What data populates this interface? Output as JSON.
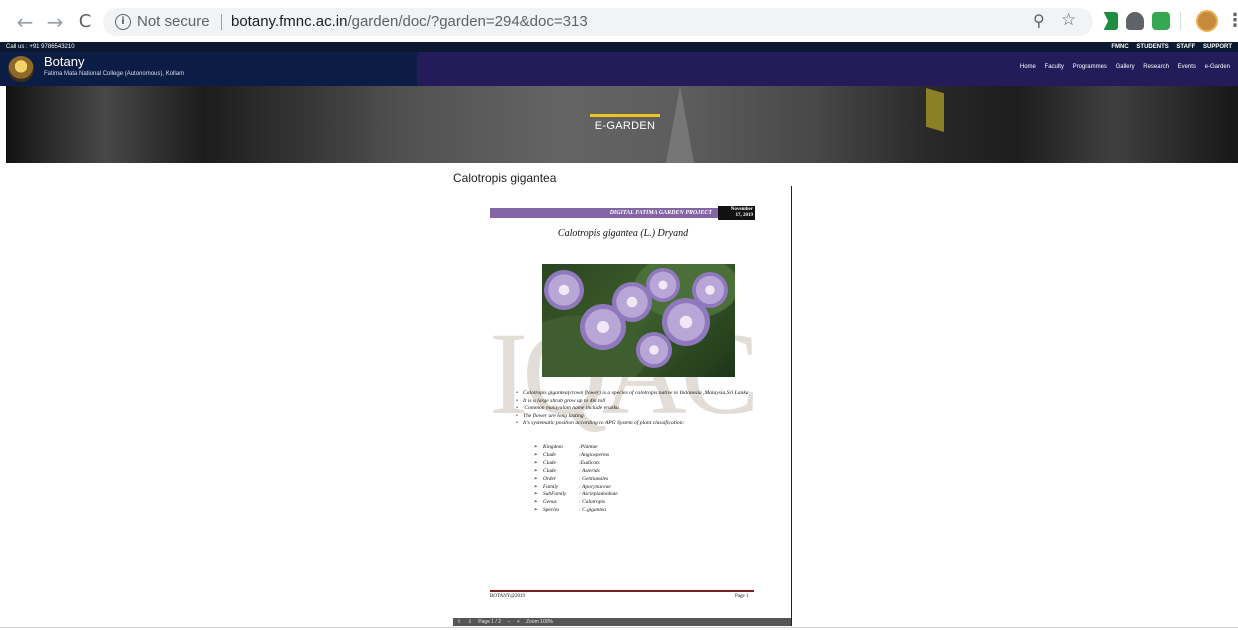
{
  "browser": {
    "security_label": "Not secure",
    "url_host": "botany.fmnc.ac.in",
    "url_path": "/garden/doc/?garden=294&doc=313"
  },
  "topbar": {
    "callus": "Call us : +91 9786543210",
    "links": [
      "FMNC",
      "STUDENTS",
      "STAFF",
      "SUPPORT"
    ]
  },
  "header": {
    "title": "Botany",
    "subtitle": "Fatima Mata National College (Autonomous), Kollam",
    "nav": [
      "Home",
      "Faculty",
      "Programmes",
      "Gallery",
      "Research",
      "Events",
      "e-Garden"
    ]
  },
  "banner": {
    "title": "E-GARDEN"
  },
  "content": {
    "doc_title": "Calotropis gigantea"
  },
  "doc": {
    "watermark": "IQAC",
    "header_label": "DIGITAL FATIMA GARDEN PROJECT",
    "date_line1": "November",
    "date_line2": "17, 2019",
    "scientific_name": "Calotropis  gigantea (L.) Dryand",
    "bullets": [
      "Calotropis gigantea(crown flower) is a species of calotropis native to Indonesia ,Malaysia,Sri Lanka",
      "It is a large shrub grow up to 4m tall",
      " Common malayalam name include erukku",
      "The flower are long lasting",
      "It's systematic position according to APG System of plant classification:"
    ],
    "taxonomy": [
      {
        "rank": "Kingdom",
        "value": ":Plantae"
      },
      {
        "rank": "Clade",
        "value": ":Angiosperms"
      },
      {
        "rank": "Clade",
        "value": ":Eudicots"
      },
      {
        "rank": "Clade",
        "value": ": Asterids"
      },
      {
        "rank": "Order",
        "value": ": Gentianales"
      },
      {
        "rank": "Family",
        "value": ": Apocynaceae"
      },
      {
        "rank": "SubFamily",
        "value": ": Asclepiadoideae"
      },
      {
        "rank": "Genus",
        "value": ": Calotropis"
      },
      {
        "rank": "Species",
        "value": ": C.gigantea"
      }
    ],
    "footer_left": "BOTANY@2019",
    "footer_right": "Page 1"
  },
  "viewer_toolbar": {
    "items": [
      "⇧",
      "⇩",
      "Page 1 / 2",
      "−",
      "+",
      "Zoom 100%"
    ]
  }
}
